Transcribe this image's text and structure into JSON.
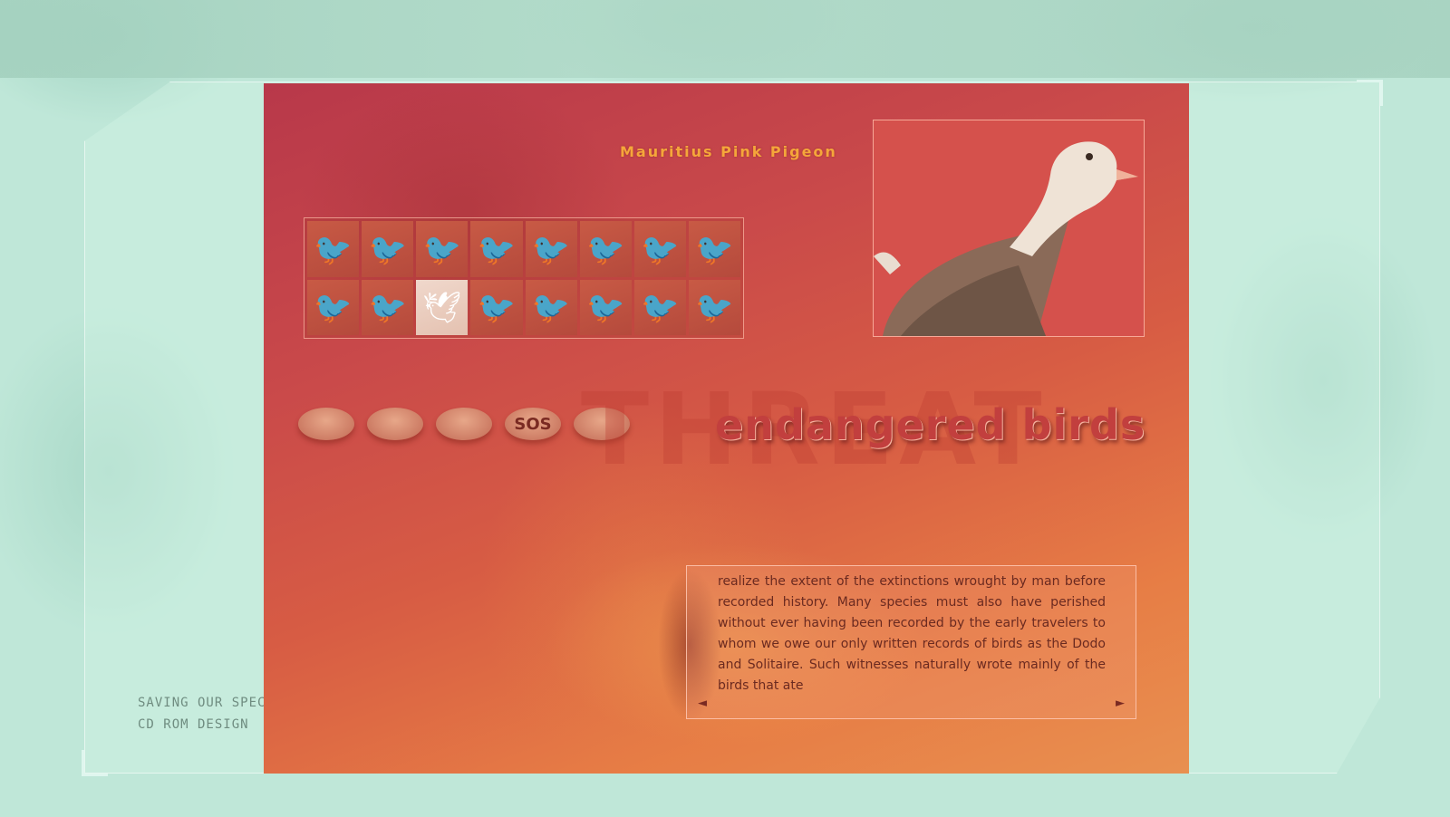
{
  "caption": {
    "line1": "SAVING OUR SPECIES",
    "line2": "CD ROM DESIGN"
  },
  "screen": {
    "bird_name": "Mauritius Pink Pigeon",
    "headline": "endangered birds",
    "ghost_word": "THREAT",
    "nav_buttons": [
      "",
      "",
      "",
      "SOS",
      ""
    ],
    "body_text": "realize the extent of the extinctions wrought by man before recorded history. Many species must also have perished without ever having been recorded by the early travelers to whom we owe our only written records of birds as the Dodo and Solitaire. Such witnesses naturally wrote mainly of the birds that ate",
    "prev_arrow": "◄",
    "next_arrow": "►"
  },
  "colors": {
    "background": "#b9e3d3",
    "screen_red": "#c9494a",
    "title_orange": "#f5a63a",
    "headline": "#c23f3e"
  }
}
